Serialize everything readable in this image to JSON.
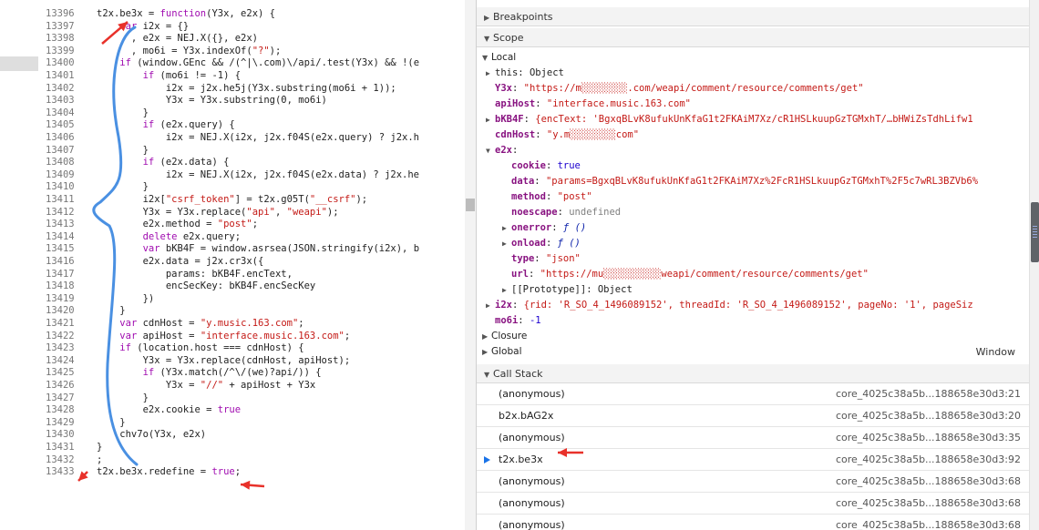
{
  "editor": {
    "lines": [
      {
        "n": "13396",
        "code": "t2x.be3x = function(Y3x, e2x) {"
      },
      {
        "n": "13397",
        "code": "    var i2x = {}"
      },
      {
        "n": "13398",
        "code": "      , e2x = NEJ.X({}, e2x)"
      },
      {
        "n": "13399",
        "code": "      , mo6i = Y3x.indexOf(\"?\");"
      },
      {
        "n": "13400",
        "code": "    if (window.GEnc && /(^|\\.com)\\/api/.test(Y3x) && !(e"
      },
      {
        "n": "13401",
        "code": "        if (mo6i != -1) {"
      },
      {
        "n": "13402",
        "code": "            i2x = j2x.he5j(Y3x.substring(mo6i + 1));"
      },
      {
        "n": "13403",
        "code": "            Y3x = Y3x.substring(0, mo6i)"
      },
      {
        "n": "13404",
        "code": "        }"
      },
      {
        "n": "13405",
        "code": "        if (e2x.query) {"
      },
      {
        "n": "13406",
        "code": "            i2x = NEJ.X(i2x, j2x.f04S(e2x.query) ? j2x.h"
      },
      {
        "n": "13407",
        "code": "        }"
      },
      {
        "n": "13408",
        "code": "        if (e2x.data) {"
      },
      {
        "n": "13409",
        "code": "            i2x = NEJ.X(i2x, j2x.f04S(e2x.data) ? j2x.he"
      },
      {
        "n": "13410",
        "code": "        }"
      },
      {
        "n": "13411",
        "code": "        i2x[\"csrf_token\"] = t2x.g05T(\"__csrf\");"
      },
      {
        "n": "13412",
        "code": "        Y3x = Y3x.replace(\"api\", \"weapi\");"
      },
      {
        "n": "13413",
        "code": "        e2x.method = \"post\";"
      },
      {
        "n": "13414",
        "code": "        delete e2x.query;"
      },
      {
        "n": "13415",
        "code": "        var bKB4F = window.asrsea(JSON.stringify(i2x), b"
      },
      {
        "n": "13416",
        "code": "        e2x.data = j2x.cr3x({"
      },
      {
        "n": "13417",
        "code": "            params: bKB4F.encText,"
      },
      {
        "n": "13418",
        "code": "            encSecKey: bKB4F.encSecKey"
      },
      {
        "n": "13419",
        "code": "        })"
      },
      {
        "n": "13420",
        "code": "    }"
      },
      {
        "n": "13421",
        "code": "    var cdnHost = \"y.music.163.com\";"
      },
      {
        "n": "13422",
        "code": "    var apiHost = \"interface.music.163.com\";"
      },
      {
        "n": "13423",
        "code": "    if (location.host === cdnHost) {"
      },
      {
        "n": "13424",
        "code": "        Y3x = Y3x.replace(cdnHost, apiHost);"
      },
      {
        "n": "13425",
        "code": "        if (Y3x.match(/^\\/(we)?api/)) {"
      },
      {
        "n": "13426",
        "code": "            Y3x = \"//\" + apiHost + Y3x"
      },
      {
        "n": "13427",
        "code": "        }"
      },
      {
        "n": "13428",
        "code": "        e2x.cookie = true"
      },
      {
        "n": "13429",
        "code": "    }"
      },
      {
        "n": "13430",
        "code": "    chv7o(Y3x, e2x)"
      },
      {
        "n": "13431",
        "code": "}"
      },
      {
        "n": "13432",
        "code": ";"
      },
      {
        "n": "13433",
        "code": "t2x.be3x.redefine = true;"
      }
    ]
  },
  "devtools": {
    "breakpoints_label": "Breakpoints",
    "scope_label": "Scope",
    "local_label": "Local",
    "local": {
      "this_key": "this",
      "this_val": "Object",
      "y3x_key": "Y3x",
      "y3x_val": "\"https://m░░░░░░░░.com/weapi/comment/resource/comments/get\"",
      "apihost_key": "apiHost",
      "apihost_val": "\"interface.music.163.com\"",
      "bkb4f_key": "bKB4F",
      "bkb4f_val": "{encText: 'BgxqBLvK8ufukUnKfaG1t2FKAiM7Xz/cR1HSLkuupGzTGMxhT/…bHWiZsTdhLifw1",
      "cdnhost_key": "cdnHost",
      "cdnhost_val": "\"y.m░░░░░░░░com\"",
      "e2x_key": "e2x",
      "cookie_key": "cookie",
      "cookie_val": "true",
      "data_key": "data",
      "data_val": "\"params=BgxqBLvK8ufukUnKfaG1t2FKAiM7Xz%2FcR1HSLkuupGzTGMxhT%2F5c7wRL3BZVb6%",
      "method_key": "method",
      "method_val": "\"post\"",
      "noescape_key": "noescape",
      "noescape_val": "undefined",
      "onerror_key": "onerror",
      "onerror_val": "ƒ ()",
      "onload_key": "onload",
      "onload_val": "ƒ ()",
      "type_key": "type",
      "type_val": "\"json\"",
      "url_key": "url",
      "url_val": "\"https://mu░░░░░░░░░░weapi/comment/resource/comments/get\"",
      "proto_key": "[[Prototype]]",
      "proto_val": "Object",
      "i2x_key": "i2x",
      "i2x_val": "{rid: 'R_SO_4_1496089152', threadId: 'R_SO_4_1496089152', pageNo: '1', pageSiz",
      "mo6i_key": "mo6i",
      "mo6i_val": "-1"
    },
    "closure_label": "Closure",
    "global_label": "Global",
    "global_value": "Window",
    "callstack_label": "Call Stack",
    "callstack": [
      {
        "fn": "(anonymous)",
        "loc": "core_4025c38a5b...188658e30d3:21"
      },
      {
        "fn": "b2x.bAG2x",
        "loc": "core_4025c38a5b...188658e30d3:20"
      },
      {
        "fn": "(anonymous)",
        "loc": "core_4025c38a5b...188658e30d3:35"
      },
      {
        "fn": "t2x.be3x",
        "loc": "core_4025c38a5b...188658e30d3:92"
      },
      {
        "fn": "(anonymous)",
        "loc": "core_4025c38a5b...188658e30d3:68"
      },
      {
        "fn": "(anonymous)",
        "loc": "core_4025c38a5b...188658e30d3:68"
      },
      {
        "fn": "(anonymous)",
        "loc": "core_4025c38a5b...188658e30d3:68"
      }
    ]
  },
  "annotation_color": "#e8312a",
  "brace_color": "#4a90e2"
}
